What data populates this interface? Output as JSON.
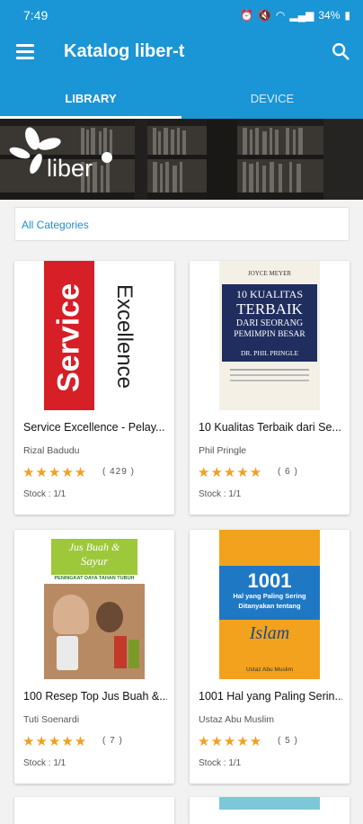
{
  "status": {
    "time": "7:49",
    "battery": "34%"
  },
  "appbar": {
    "title": "Katalog liber-t"
  },
  "tabs": [
    {
      "label": "LIBRARY"
    },
    {
      "label": "DEVICE"
    }
  ],
  "banner": {
    "logo_text": "liber"
  },
  "filter": {
    "label": "All Categories"
  },
  "books": [
    {
      "title": "Service Excellence - Pelay...",
      "author": "Rizal Badudu",
      "rating": "( 429 )",
      "stock": "Stock : 1/1",
      "cover": {
        "main": "Service",
        "side": "Excellence"
      }
    },
    {
      "title": "10 Kualitas Terbaik dari Se...",
      "author": "Phil Pringle",
      "rating": "( 6 )",
      "stock": "Stock : 1/1",
      "cover": {
        "line1": "10 KUALITAS",
        "line2": "TERBAIK",
        "line3": "DARI SEORANG",
        "line4": "PEMIMPIN BESAR",
        "author": "DR. PHIL PRINGLE",
        "top": "JOYCE MEYER"
      }
    },
    {
      "title": "100 Resep Top Jus Buah &...",
      "author": "Tuti Soenardi",
      "rating": "( 7 )",
      "stock": "Stock : 1/1",
      "cover": {
        "line1": "Jus Buah &",
        "line2": "Sayur",
        "band": "PENINGKAT DAYA TAHAN TUBUH"
      }
    },
    {
      "title": "1001 Hal yang Paling Serin...",
      "author": "Ustaz Abu Muslim",
      "rating": "( 5 )",
      "stock": "Stock : 1/1",
      "cover": {
        "line1": "1001",
        "line2": "Hal yang Paling Sering",
        "line3": "Ditanyakan tentang",
        "line4": "Islam",
        "author": "Ustaz Abu Muslim"
      }
    }
  ],
  "stars_glyph": "★★★★★",
  "colors": {
    "primary": "#1a95d6",
    "star": "#f2a020"
  }
}
